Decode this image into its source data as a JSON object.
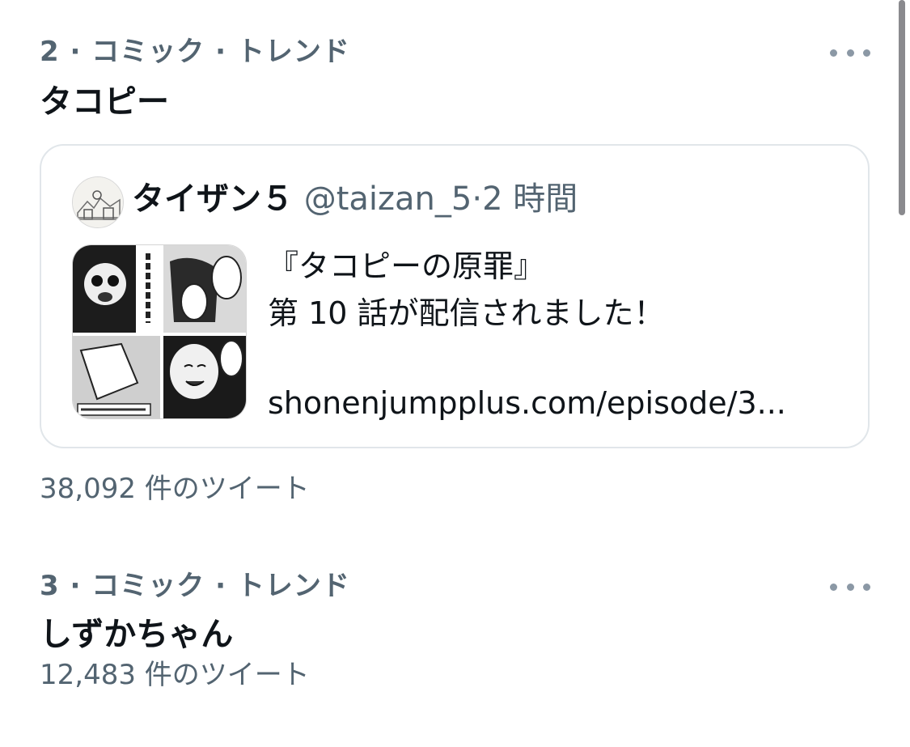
{
  "trends": [
    {
      "meta": "2 · コミック · トレンド",
      "name": "タコピー",
      "count": "38,092 件のツイート",
      "tweet": {
        "display_name": "タイザン５",
        "handle": "@taizan_5",
        "separator": "·",
        "time": "2 時間",
        "text_line1": "『タコピーの原罪』",
        "text_line2": "第 10 話が配信されました！",
        "link": "shonenjumpplus.com/episode/3..."
      }
    },
    {
      "meta": "3 · コミック · トレンド",
      "name": "しずかちゃん",
      "count": "12,483 件のツイート"
    }
  ],
  "icons": {
    "more": "more-horizontal-icon"
  },
  "colors": {
    "primary_text": "#0f1419",
    "secondary_text": "#536471",
    "card_border": "#e1e6ea",
    "more_dots": "#8b98a5"
  }
}
